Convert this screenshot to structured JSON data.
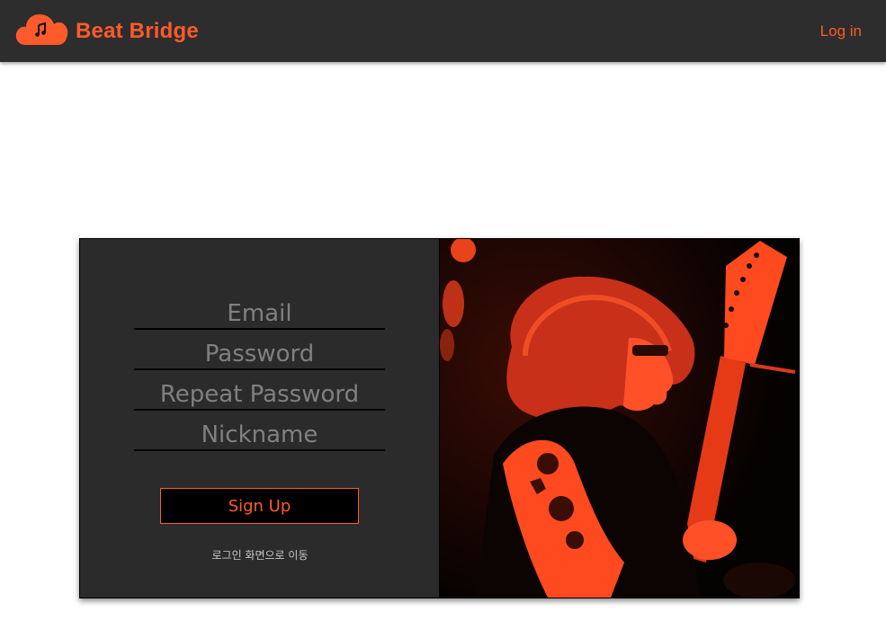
{
  "header": {
    "brand_name": "Beat Bridge",
    "logo_icon": "cloud-music-icon",
    "login_label": "Log in"
  },
  "signup_form": {
    "email_placeholder": "Email",
    "password_placeholder": "Password",
    "repeat_password_placeholder": "Repeat Password",
    "nickname_placeholder": "Nickname",
    "submit_label": "Sign Up",
    "goto_login_label": "로그인 화면으로 이동"
  },
  "hero_image": {
    "subject": "guitarist-photo"
  },
  "colors": {
    "accent": "#ff5a2c",
    "header_bg": "#2d2d2d",
    "panel_bg": "#2b2b2b",
    "page_bg": "#ffffff"
  }
}
